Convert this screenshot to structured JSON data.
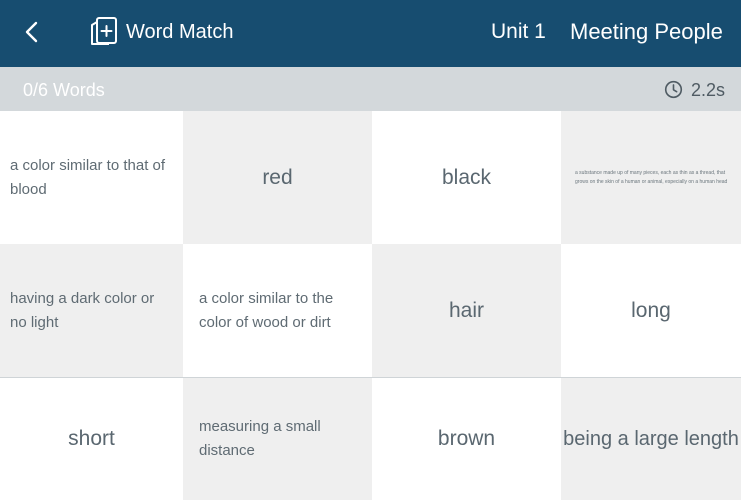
{
  "header": {
    "back_icon": "chevron-left-icon",
    "brand_icon": "flashcard-add-icon",
    "brand_title": "Word Match",
    "unit": "Unit 1",
    "topic": "Meeting People",
    "background_color": "#174d70"
  },
  "status": {
    "progress": "0/6 Words",
    "timer_icon": "clock-icon",
    "timer": "2.2s"
  },
  "cards": [
    {
      "text": "a color similar to that of blood"
    },
    {
      "text": "red"
    },
    {
      "text": "black"
    },
    {
      "text": "a substance made up of many pieces, each as thin as a thread, that grows on the skin of a human or animal, especially on a human head"
    },
    {
      "text": "having a dark color or no light"
    },
    {
      "text": "a color similar to the color of wood or dirt"
    },
    {
      "text": "hair"
    },
    {
      "text": "long"
    },
    {
      "text": "short"
    },
    {
      "text": "measuring a small distance"
    },
    {
      "text": "brown"
    },
    {
      "text": "being a large length"
    }
  ]
}
